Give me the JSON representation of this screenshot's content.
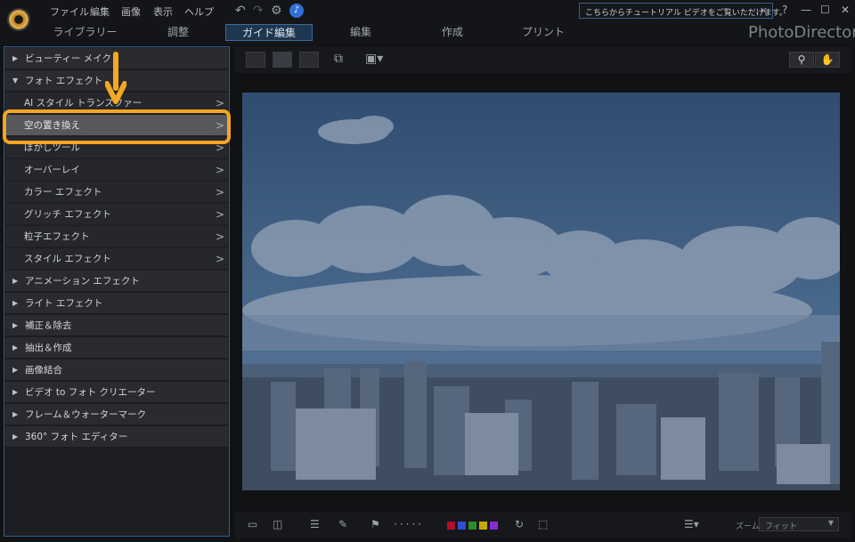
{
  "menu": [
    "ファイル",
    "編集",
    "画像",
    "表示",
    "ヘルプ"
  ],
  "tip": {
    "text": "こちらからチュートリアル ビデオをご覧いただけます。",
    "close": "×"
  },
  "window_controls": {
    "help": "?",
    "minimize": "—",
    "maximize": "☐",
    "close": "✕"
  },
  "tabs": [
    "ライブラリー",
    "調整",
    "ガイド編集",
    "編集",
    "作成",
    "プリント"
  ],
  "active_tab": "ガイド編集",
  "brand": "PhotoDirector",
  "panel": {
    "beauty": "ビューティー メイク",
    "photo_effects": "フォト エフェクト",
    "subitems": [
      "AI スタイル トランスファー",
      "空の置き換え",
      "ぼかしツール",
      "オーバーレイ",
      "カラー エフェクト",
      "グリッチ エフェクト",
      "粒子エフェクト",
      "スタイル エフェクト"
    ],
    "selected": "空の置き換え",
    "categories": [
      "アニメーション エフェクト",
      "ライト エフェクト",
      "補正＆除去",
      "抽出＆作成",
      "画像結合",
      "ビデオ to フォト クリエーター",
      "フレーム＆ウォーターマーク",
      "360° フォト エディター"
    ]
  },
  "bottom": {
    "zoom_label": "ズーム:",
    "zoom_value": "フィット"
  },
  "colors": {
    "accent": "#f5a623",
    "selected_bg": "#56585c",
    "tab_active": "#1e3650",
    "label_colors": [
      "#b0102a",
      "#2a4fd0",
      "#2d8a2d",
      "#c8a800",
      "#8a2bd0"
    ]
  }
}
